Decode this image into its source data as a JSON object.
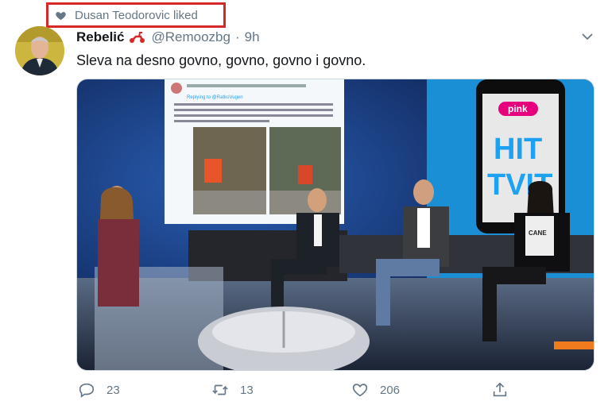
{
  "social_context": {
    "text": "Dusan Teodorovic liked"
  },
  "tweet": {
    "author_name": "Rebelić",
    "handle": "@Remoozbg",
    "separator": "·",
    "time": "9h",
    "text": "Sleva na desno govno, govno, govno i govno."
  },
  "media": {
    "embedded_tweet_reply": "Replying to @RatkoVugen",
    "brand_logo": "pink",
    "show_title_line1": "HIT",
    "show_title_line2": "TVIT",
    "tshirt_text": "CANE"
  },
  "actions": {
    "reply_count": "23",
    "retweet_count": "13",
    "like_count": "206"
  },
  "colors": {
    "accent": "#1da1f2",
    "muted": "#657786",
    "highlight_border": "#d62828"
  }
}
